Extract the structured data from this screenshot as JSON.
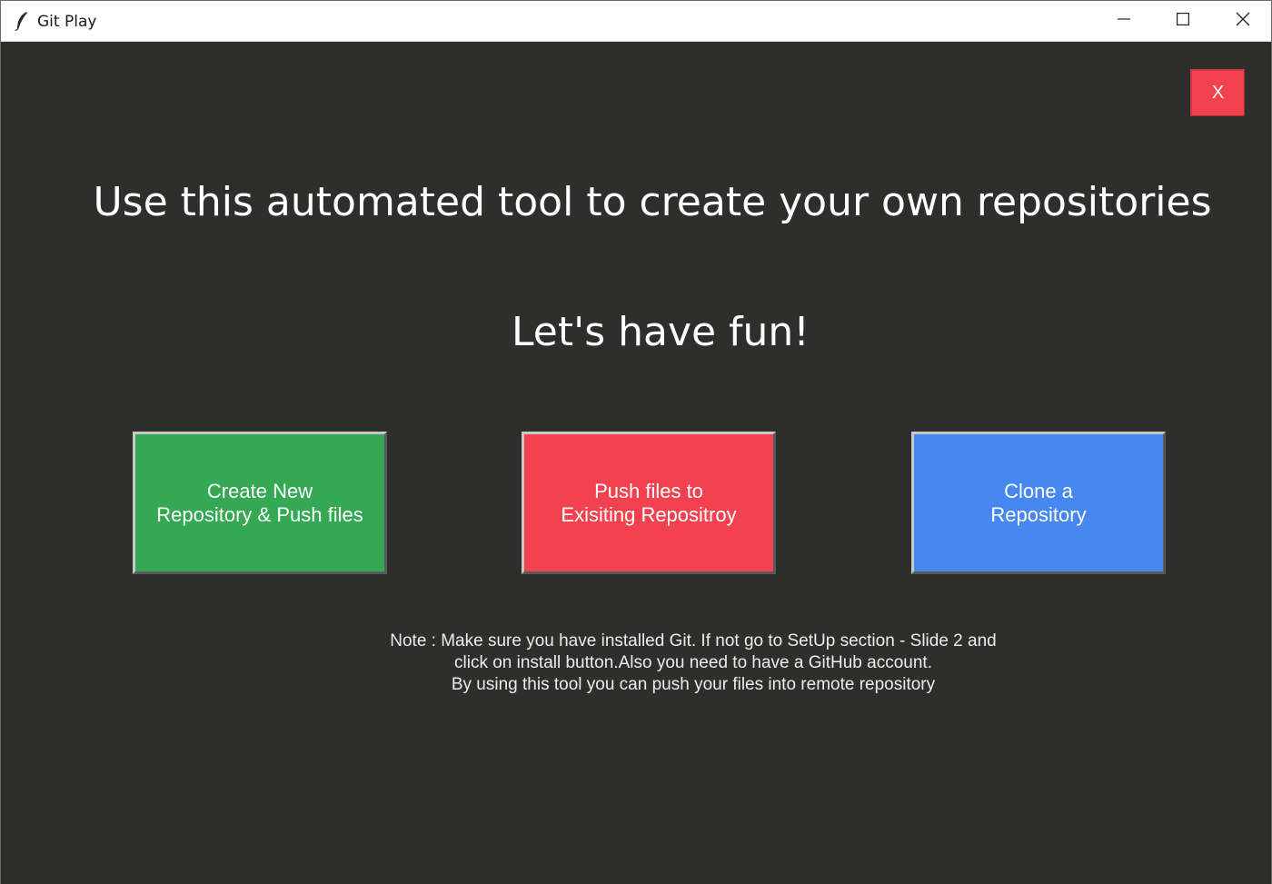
{
  "window": {
    "title": "Git Play",
    "icon": "feather-icon"
  },
  "titlebar_buttons": {
    "minimize_icon": "minimize-icon",
    "maximize_icon": "maximize-icon",
    "close_icon": "close-icon"
  },
  "main": {
    "exit_label": "X",
    "headline": "Use this automated tool to create your own repositories",
    "subheadline": "Let's have fun!",
    "buttons": [
      {
        "label": "Create New\nRepository & Push files",
        "color": "#34a853"
      },
      {
        "label": "Push files to\nExisiting Repositroy",
        "color": "#f24250"
      },
      {
        "label": "Clone a\nRepository",
        "color": "#4787f0"
      }
    ],
    "note": "Note : Make sure you have installed Git. If not go to SetUp section - Slide 2 and\nclick on install button.Also you need to have a GitHub account.\nBy using this tool you can push your files into remote repository"
  },
  "colors": {
    "background": "#2e2f2d",
    "exit_button": "#f24250",
    "text": "#ffffff"
  }
}
